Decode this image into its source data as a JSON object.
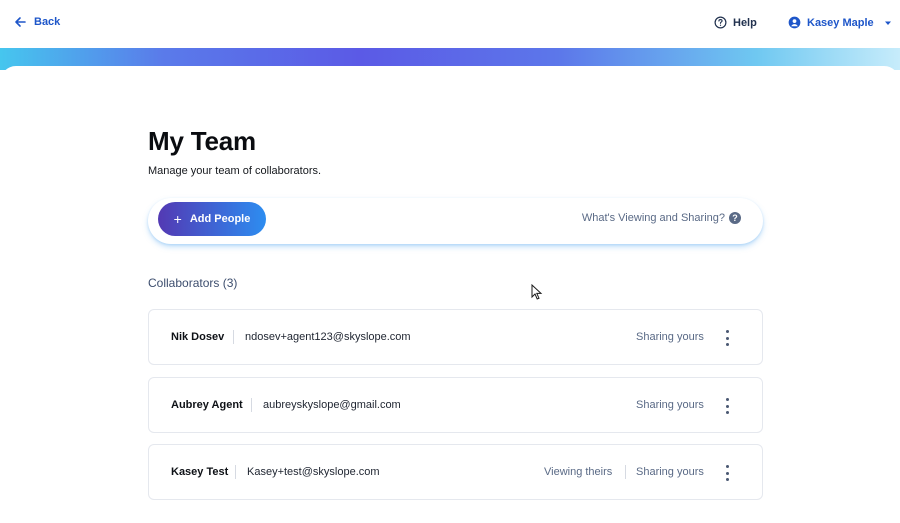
{
  "header": {
    "back_label": "Back",
    "help_label": "Help",
    "user_name": "Kasey Maple"
  },
  "page": {
    "title": "My Team",
    "subtitle": "Manage your team of collaborators."
  },
  "actions": {
    "add_people_label": "Add People",
    "whats_viewing_label": "What's Viewing and Sharing?"
  },
  "collaborators": {
    "heading": "Collaborators (3)",
    "rows": [
      {
        "name": "Nik Dosev",
        "email": "ndosev+agent123@skyslope.com",
        "viewing": "",
        "sharing": "Sharing yours"
      },
      {
        "name": "Aubrey Agent",
        "email": "aubreyskyslope@gmail.com",
        "viewing": "",
        "sharing": "Sharing yours"
      },
      {
        "name": "Kasey Test",
        "email": "Kasey+test@skyslope.com",
        "viewing": "Viewing theirs",
        "sharing": "Sharing yours"
      }
    ]
  },
  "colors": {
    "brand_blue": "#1e56c9",
    "button_gradient_start": "#5339b3",
    "button_gradient_end": "#2d8df0",
    "muted_text": "#5a6a86"
  },
  "icons": {
    "back": "arrow-left-icon",
    "help": "question-circle-icon",
    "user": "user-circle-icon",
    "caret": "chevron-down-icon",
    "add": "plus-icon",
    "info": "question-icon",
    "menu": "kebab-menu-icon"
  }
}
